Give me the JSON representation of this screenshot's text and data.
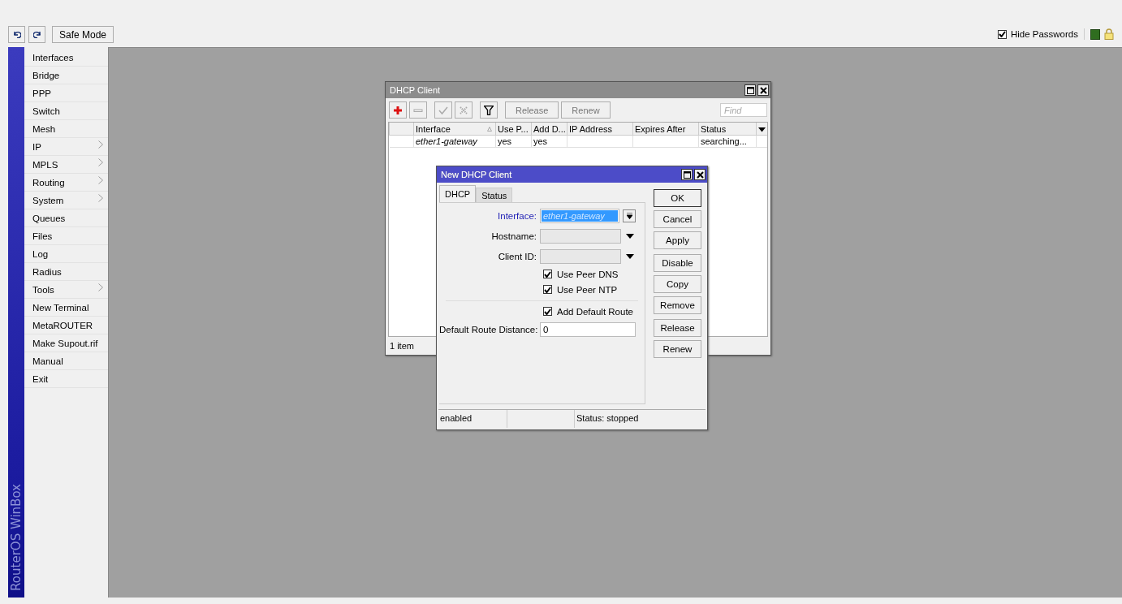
{
  "toolbar": {
    "safe_mode": "Safe Mode",
    "hide_passwords": {
      "label": "Hide Passwords",
      "checked": true
    }
  },
  "brand": "RouterOS WinBox",
  "menu": [
    {
      "label": "Interfaces",
      "submenu": false
    },
    {
      "label": "Bridge",
      "submenu": false
    },
    {
      "label": "PPP",
      "submenu": false
    },
    {
      "label": "Switch",
      "submenu": false
    },
    {
      "label": "Mesh",
      "submenu": false
    },
    {
      "label": "IP",
      "submenu": true
    },
    {
      "label": "MPLS",
      "submenu": true
    },
    {
      "label": "Routing",
      "submenu": true
    },
    {
      "label": "System",
      "submenu": true
    },
    {
      "label": "Queues",
      "submenu": false
    },
    {
      "label": "Files",
      "submenu": false
    },
    {
      "label": "Log",
      "submenu": false
    },
    {
      "label": "Radius",
      "submenu": false
    },
    {
      "label": "Tools",
      "submenu": true
    },
    {
      "label": "New Terminal",
      "submenu": false
    },
    {
      "label": "MetaROUTER",
      "submenu": false
    },
    {
      "label": "Make Supout.rif",
      "submenu": false
    },
    {
      "label": "Manual",
      "submenu": false
    },
    {
      "label": "Exit",
      "submenu": false
    }
  ],
  "dhcp_window": {
    "title": "DHCP Client",
    "tools": [
      {
        "kind": "add",
        "disabled": false
      },
      {
        "kind": "remove",
        "disabled": true
      },
      {
        "kind": "enable",
        "disabled": true
      },
      {
        "kind": "disable",
        "disabled": true
      },
      {
        "kind": "filter",
        "disabled": false
      }
    ],
    "buttons": [
      {
        "label": "Release",
        "disabled": true
      },
      {
        "label": "Renew",
        "disabled": true
      }
    ],
    "find": {
      "placeholder": "Find"
    },
    "columns": [
      {
        "label": "Interface",
        "sorted": true
      },
      {
        "label": "Use P...",
        "sorted": false
      },
      {
        "label": "Add D...",
        "sorted": false
      },
      {
        "label": "IP Address",
        "sorted": false
      },
      {
        "label": "Expires After",
        "sorted": false
      },
      {
        "label": "Status",
        "sorted": false
      }
    ],
    "rows": [
      [
        "ether1-gateway",
        "yes",
        "yes",
        null,
        null,
        "searching..."
      ]
    ],
    "count": "1 item"
  },
  "dialog": {
    "title": "New DHCP Client",
    "tabs": [
      {
        "label": "DHCP",
        "selected": true
      },
      {
        "label": "Status",
        "selected": false
      }
    ],
    "fields": [
      {
        "kind": "select",
        "label": "Interface:",
        "value": "ether1-gateway",
        "highlighted": true
      },
      {
        "kind": "dropdown",
        "label": "Hostname:"
      },
      {
        "kind": "dropdown",
        "label": "Client ID:"
      },
      {
        "kind": "check",
        "label": "Use Peer DNS",
        "checked": true
      },
      {
        "kind": "check",
        "label": "Use Peer NTP",
        "checked": true
      },
      {
        "kind": "separator"
      },
      {
        "kind": "check",
        "label": "Add Default Route",
        "checked": true
      },
      {
        "kind": "text",
        "label": "Default Route Distance:",
        "value": "0"
      }
    ],
    "button_groups": [
      [
        {
          "label": "OK",
          "default": true
        },
        {
          "label": "Cancel",
          "default": false
        },
        {
          "label": "Apply",
          "default": false
        }
      ],
      [
        {
          "label": "Disable",
          "default": false
        },
        {
          "label": "Copy",
          "default": false
        },
        {
          "label": "Remove",
          "default": false
        }
      ],
      [
        {
          "label": "Release",
          "default": false
        },
        {
          "label": "Renew",
          "default": false
        }
      ]
    ],
    "status_left": "enabled",
    "status_right": "Status: stopped"
  }
}
